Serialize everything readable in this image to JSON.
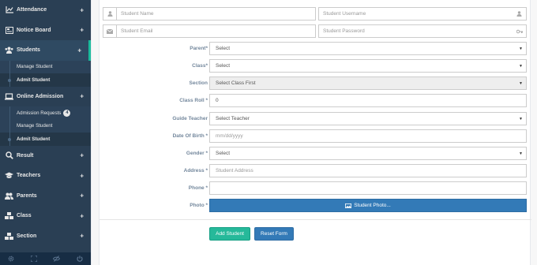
{
  "sidebar": {
    "items": [
      {
        "label": "Attendance",
        "icon": "chart-icon"
      },
      {
        "label": "Notice Board",
        "icon": "board-icon"
      },
      {
        "label": "Students",
        "icon": "users-icon"
      },
      {
        "label": "Online Admission",
        "icon": "laptop-icon"
      },
      {
        "label": "Result",
        "icon": "search-icon"
      },
      {
        "label": "Teachers",
        "icon": "graduation-cap-icon"
      },
      {
        "label": "Parents",
        "icon": "user-group-icon"
      },
      {
        "label": "Class",
        "icon": "cubes-icon"
      },
      {
        "label": "Section",
        "icon": "cubes-icon"
      }
    ],
    "students_sub": [
      "Manage Student",
      "Admit Student"
    ],
    "admission_sub": [
      "Admission Requests",
      "Manage Student",
      "Admit Student"
    ],
    "admission_requests_count": "4",
    "expand_symbol": "+"
  },
  "top_fields": {
    "name_placeholder": "Student Name",
    "username_placeholder": "Student Username",
    "email_placeholder": "Student Email",
    "password_placeholder": "Student Password"
  },
  "form": {
    "parent_label": "Parent*",
    "parent_value": "Select",
    "class_label": "Class*",
    "class_value": "Select",
    "section_label": "Section",
    "section_value": "Select Class First",
    "roll_label": "Class Roll *",
    "roll_value": "0",
    "teacher_label": "Guide Teacher",
    "teacher_value": "Select Teacher",
    "dob_label": "Date Of Birth *",
    "dob_placeholder": "mm/dd/yyyy",
    "gender_label": "Gender *",
    "gender_value": "Select",
    "address_label": "Address *",
    "address_placeholder": "Student Address",
    "phone_label": "Phone *",
    "phone_value": "",
    "photo_label": "Photo *",
    "photo_button": "Student Photo..."
  },
  "buttons": {
    "add": "Add Student",
    "reset": "Reset Form"
  },
  "colors": {
    "sidebar": "#2a3f54",
    "accent": "#1abb9c",
    "primary": "#337ab7",
    "success": "#26b99a"
  }
}
